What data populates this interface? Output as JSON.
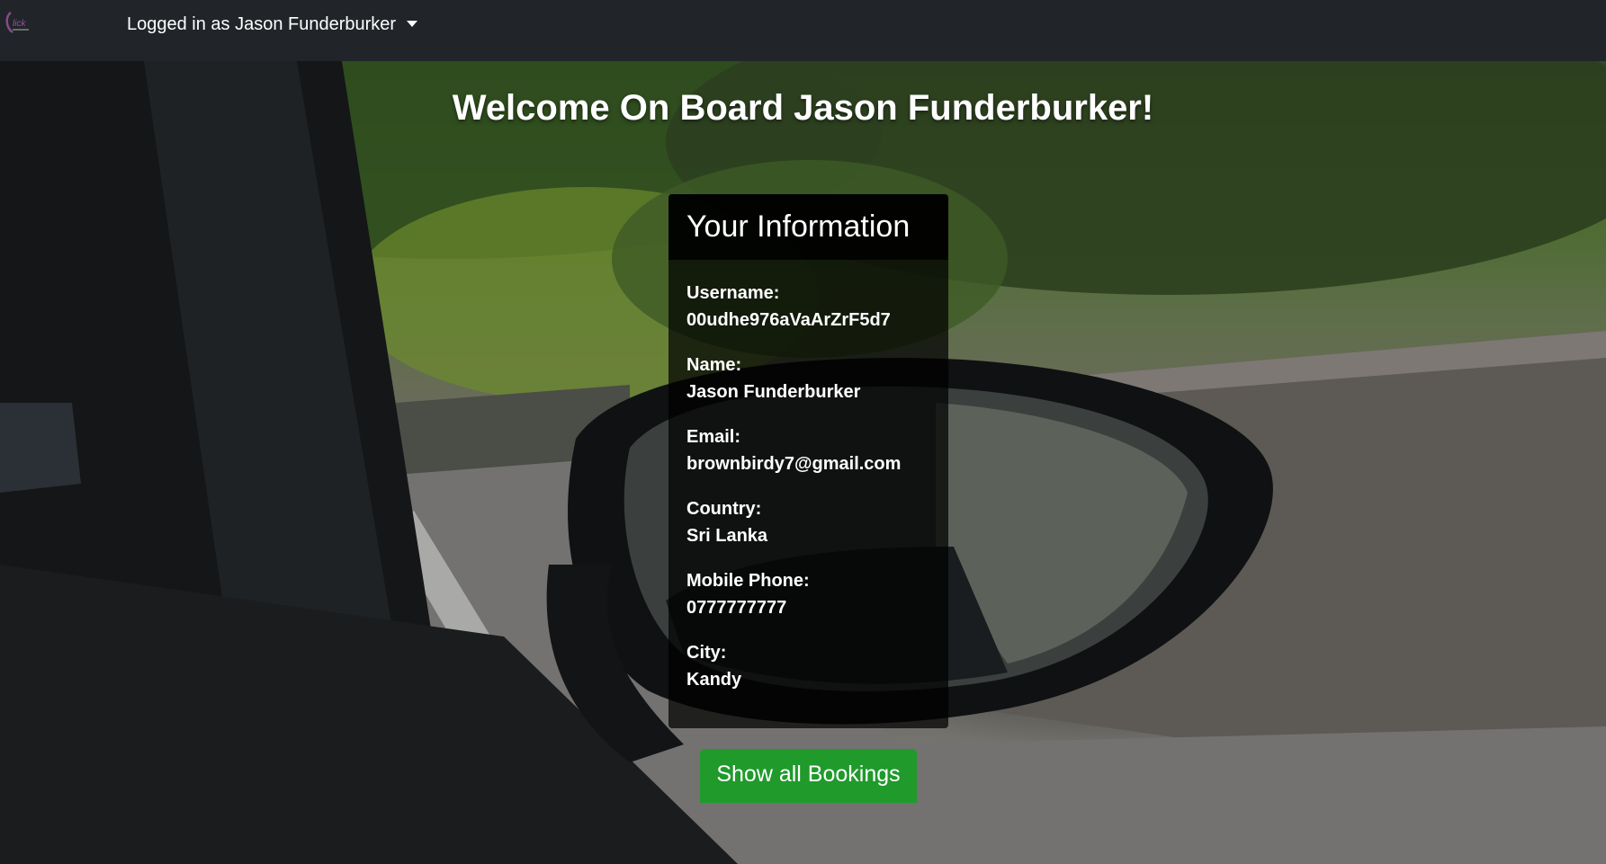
{
  "navbar": {
    "logo_icon": "click-logo",
    "user_menu_label": "Logged in as Jason Funderburker",
    "user_menu_icon": "chevron-down-icon"
  },
  "hero": {
    "welcome_text": "Welcome On Board Jason Funderburker!"
  },
  "info_card": {
    "title": "Your Information",
    "fields": [
      {
        "label": "Username:",
        "value": "00udhe976aVaArZrF5d7"
      },
      {
        "label": "Name:",
        "value": "Jason Funderburker"
      },
      {
        "label": "Email:",
        "value": "brownbirdy7@gmail.com"
      },
      {
        "label": "Country:",
        "value": "Sri Lanka"
      },
      {
        "label": "Mobile Phone:",
        "value": "0777777777"
      },
      {
        "label": "City:",
        "value": "Kandy"
      }
    ]
  },
  "actions": {
    "show_bookings_label": "Show all Bookings"
  },
  "colors": {
    "navbar_bg": "#212529",
    "button_green": "#1f9a2b",
    "text_white": "#ffffff"
  }
}
